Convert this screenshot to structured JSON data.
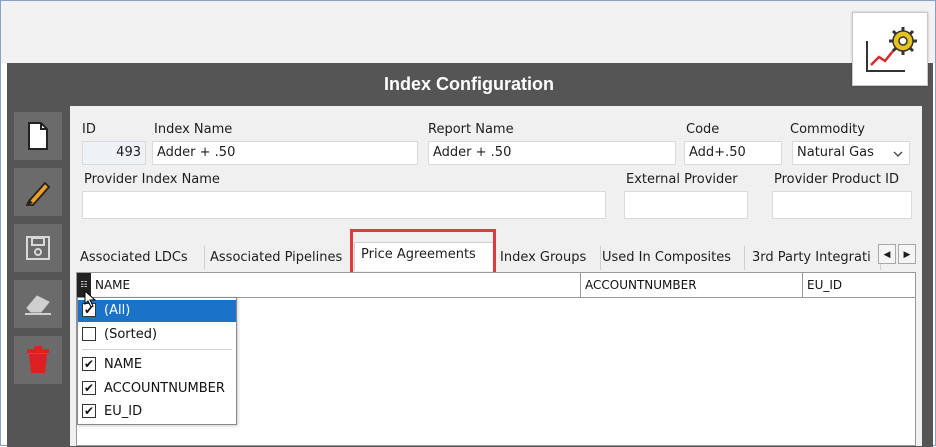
{
  "window": {
    "title": "Index Configuration"
  },
  "icons": {
    "logo": "chart-gear-icon",
    "new": "document-icon",
    "edit": "pencil-icon",
    "save": "save-icon",
    "clear": "eraser-icon",
    "delete": "trash-icon"
  },
  "colors": {
    "accent": "#1a73c9",
    "highlight": "#e0393e",
    "logo_gear": "#e8c21f",
    "logo_line": "#d92b2b",
    "delete": "#e02020"
  },
  "form": {
    "id": {
      "label": "ID",
      "value": "493"
    },
    "index_name": {
      "label": "Index Name",
      "value": "Adder + .50"
    },
    "report_name": {
      "label": "Report Name",
      "value": "Adder + .50"
    },
    "code": {
      "label": "Code",
      "value": "Add+.50"
    },
    "commodity": {
      "label": "Commodity",
      "value": "Natural Gas"
    },
    "provider_index_name": {
      "label": "Provider Index Name",
      "value": ""
    },
    "external_provider": {
      "label": "External Provider",
      "value": ""
    },
    "provider_product_id": {
      "label": "Provider Product ID",
      "value": ""
    }
  },
  "tabs": [
    "Associated LDCs",
    "Associated Pipelines",
    "Price Agreements",
    "Index Groups",
    "Used In Composites",
    "3rd Party Integrati"
  ],
  "active_tab": "Price Agreements",
  "nav": {
    "prev": "◀",
    "next": "▶"
  },
  "grid": {
    "chooser_glyph": "☷",
    "columns": [
      "NAME",
      "ACCOUNTNUMBER",
      "EU_ID"
    ]
  },
  "column_menu": {
    "items": [
      {
        "label": "(All)",
        "checked": true,
        "selected": true,
        "check": "✔"
      },
      {
        "label": "(Sorted)",
        "checked": false,
        "selected": false,
        "check": ""
      },
      {
        "label": "NAME",
        "checked": true,
        "selected": false,
        "check": "✔"
      },
      {
        "label": "ACCOUNTNUMBER",
        "checked": true,
        "selected": false,
        "check": "✔"
      },
      {
        "label": "EU_ID",
        "checked": true,
        "selected": false,
        "check": "✔"
      }
    ]
  }
}
